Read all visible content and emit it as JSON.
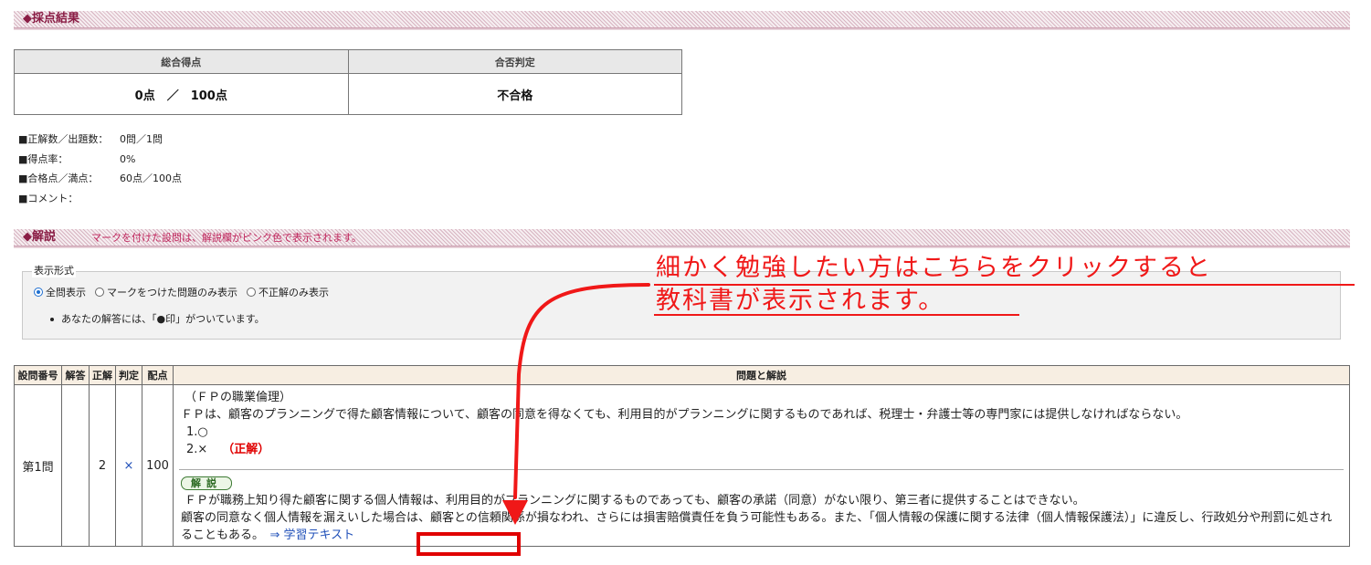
{
  "results_section": {
    "title": "◆採点結果"
  },
  "score_table": {
    "headers": [
      "総合得点",
      "合否判定"
    ],
    "total_score": "0点　／　100点",
    "verdict": "不合格"
  },
  "stats": [
    {
      "label": "■正解数／出題数：",
      "value": "0問／1問"
    },
    {
      "label": "■得点率：",
      "value": "0%"
    },
    {
      "label": "■合格点／満点：",
      "value": "60点／100点"
    },
    {
      "label": "■コメント：",
      "value": ""
    }
  ],
  "explanation_section": {
    "title": "◆解説",
    "note": "マークを付けた設問は、解説欄がピンク色で表示されます。"
  },
  "display_mode": {
    "legend": "表示形式",
    "options": [
      {
        "label": "全問表示",
        "checked": true
      },
      {
        "label": "マークをつけた問題のみ表示",
        "checked": false
      },
      {
        "label": "不正解のみ表示",
        "checked": false
      }
    ],
    "note": "あなたの解答には、「●印」がついています。"
  },
  "question_table": {
    "headers": [
      "設問番号",
      "解答",
      "正解",
      "判定",
      "配点",
      "問題と解説"
    ],
    "rows": [
      {
        "number": "第1問",
        "answer": "",
        "correct_answer": "2",
        "judgement": "×",
        "points": "100",
        "category": "（ＦＰの職業倫理）",
        "question": "ＦＰは、顧客のプランニングで得た顧客情報について、顧客の同意を得なくても、利用目的がプランニングに関するものであれば、税理士・弁護士等の専門家には提供しなければならない。",
        "choices": [
          "1.○",
          "2.×"
        ],
        "correct_label": "（正解）",
        "explanation_badge": "解説",
        "explanation": [
          "ＦＰが職務上知り得た顧客に関する個人情報は、利用目的がプランニングに関するものであっても、顧客の承諾（同意）がない限り、第三者に提供することはできない。",
          "顧客の同意なく個人情報を漏えいした場合は、顧客との信頼関係が損なわれ、さらには損害賠償責任を負う可能性もある。また、「個人情報の保護に関する法律（個人情報保護法）」に違反し、行政処分や刑罰に処されることもある。"
        ],
        "study_link": "⇒ 学習テキスト"
      }
    ]
  },
  "annotation": {
    "line1": "細かく勉強したい方はこちらをクリックすると",
    "line2": "教科書が表示されます。",
    "color": "#f01818"
  }
}
